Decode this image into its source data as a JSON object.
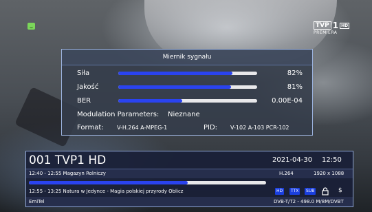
{
  "overlay": {
    "title": "Miernik sygnału",
    "strength": {
      "label": "Siła",
      "value": "82%",
      "level": 0.82
    },
    "quality": {
      "label": "Jakość",
      "value": "81%",
      "level": 0.81
    },
    "ber": {
      "label": "BER",
      "value": "0.00E-04",
      "level": 0.46
    },
    "modulation": {
      "label": "Modulation Parameters:",
      "value": "Nieznane"
    },
    "format": {
      "label": "Format:",
      "value": "V-H.264 A-MPEG-1"
    },
    "pid": {
      "label": "PID:",
      "value": "V-102 A-103 PCR-102"
    }
  },
  "logo": {
    "brand": "TVP",
    "number": "1",
    "hd": "HD",
    "sub": "PREMIERA"
  },
  "info_bar": {
    "channel": "001  TVP1 HD",
    "date": "2021-04-30",
    "time": "12:50",
    "current_program": "12:40 - 12:55  Magazyn Rolniczy",
    "codec": "H.264",
    "resolution": "1920 x 1088",
    "progress": 0.67,
    "next_program": "12:55 - 13:25  Natura w Jedynce - Magia polskiej przyrody  Oblicz",
    "badges": [
      "HD",
      "TTX",
      "SUB"
    ],
    "dollar": "$",
    "provider": "EmiTel",
    "transmission": "DVB-T/T2 - 498.0 M/8M/DVBT"
  },
  "colors": {
    "bar_fill": "#2a43f0",
    "badge": "#1a3fe0",
    "channel_icon": "#7bd65a"
  }
}
